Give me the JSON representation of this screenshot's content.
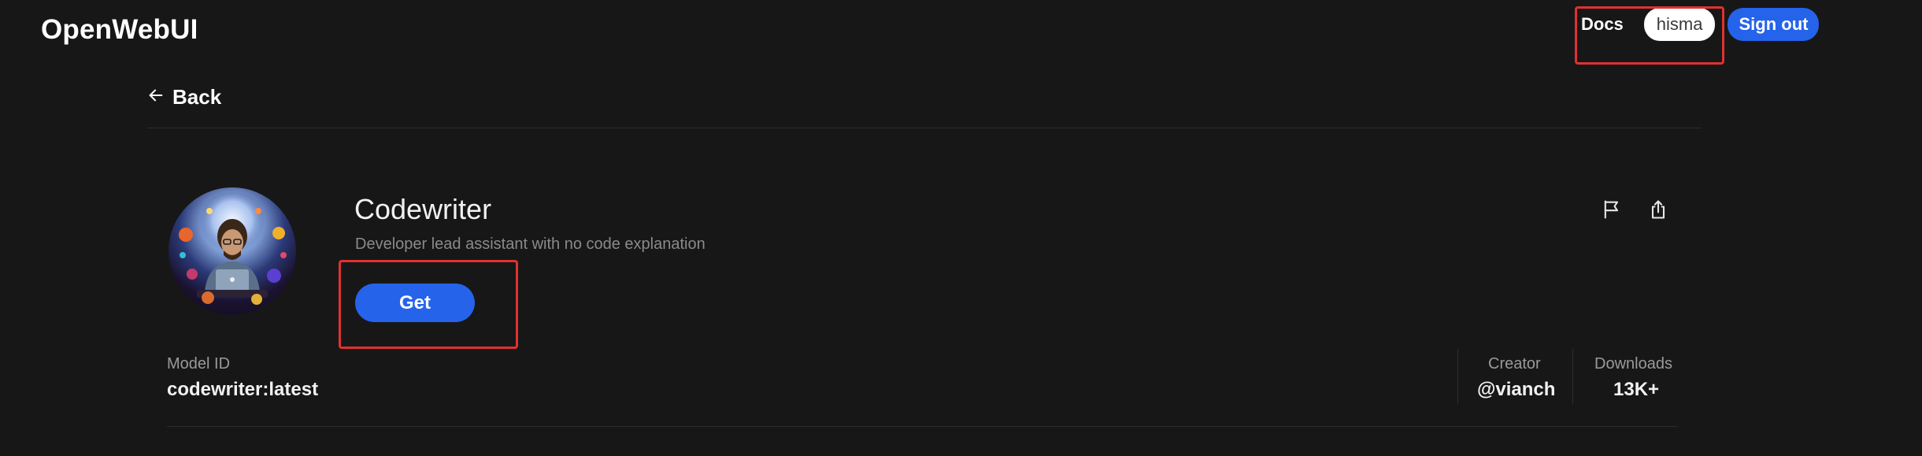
{
  "app": {
    "brand": "OpenWebUI"
  },
  "header": {
    "docs_label": "Docs",
    "username": "hisma",
    "signout_label": "Sign out"
  },
  "nav": {
    "back_label": "Back"
  },
  "model": {
    "name": "Codewriter",
    "description": "Developer lead assistant with no code explanation",
    "get_label": "Get",
    "id_label": "Model ID",
    "id_value": "codewriter:latest",
    "creator_label": "Creator",
    "creator_value": "@vianch",
    "downloads_label": "Downloads",
    "downloads_value": "13K+"
  },
  "icons": {
    "back": "arrow-left-icon",
    "report": "flag-icon",
    "share": "share-icon"
  },
  "colors": {
    "background": "#171717",
    "accent": "#2563eb",
    "highlight": "#e03131"
  }
}
